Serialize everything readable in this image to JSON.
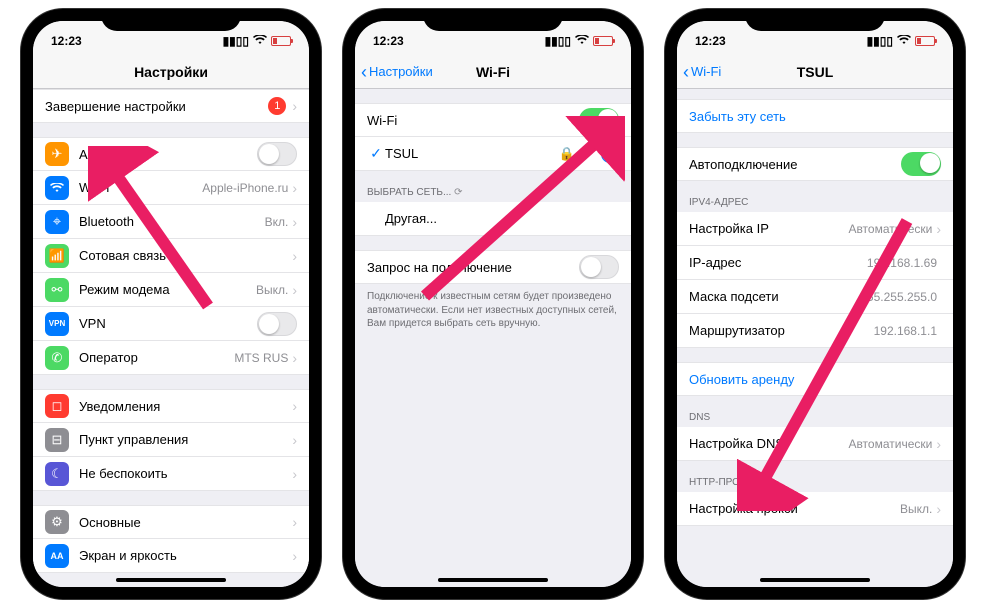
{
  "status": {
    "time": "12:23"
  },
  "phone1": {
    "title": "Настройки",
    "complete_row": {
      "label": "Завершение настройки",
      "badge": "1"
    },
    "rows": {
      "airplane": {
        "label": "Авиарежим"
      },
      "wifi": {
        "label": "Wi-Fi",
        "value": "Apple-iPhone.ru"
      },
      "bluetooth": {
        "label": "Bluetooth",
        "value": "Вкл."
      },
      "cellular": {
        "label": "Сотовая связь"
      },
      "hotspot": {
        "label": "Режим модема",
        "value": "Выкл."
      },
      "vpn": {
        "label": "VPN"
      },
      "carrier": {
        "label": "Оператор",
        "value": "MTS RUS"
      },
      "notifications": {
        "label": "Уведомления"
      },
      "control": {
        "label": "Пункт управления"
      },
      "dnd": {
        "label": "Не беспокоить"
      },
      "general": {
        "label": "Основные"
      },
      "display": {
        "label": "Экран и яркость"
      }
    }
  },
  "phone2": {
    "back": "Настройки",
    "title": "Wi-Fi",
    "wifi_label": "Wi-Fi",
    "network": "TSUL",
    "choose_header": "ВЫБРАТЬ СЕТЬ...",
    "other": "Другая...",
    "ask_label": "Запрос на подключение",
    "ask_footer": "Подключение к известным сетям будет произведено автоматически. Если нет известных доступных сетей, Вам придется выбрать сеть вручную."
  },
  "phone3": {
    "back": "Wi-Fi",
    "title": "TSUL",
    "forget": "Забыть эту сеть",
    "autojoin": "Автоподключение",
    "ipv4_header": "IPV4-АДРЕС",
    "ip_config": {
      "label": "Настройка IP",
      "value": "Автоматически"
    },
    "ip": {
      "label": "IP-адрес",
      "value": "192.168.1.69"
    },
    "mask": {
      "label": "Маска подсети",
      "value": "255.255.255.0"
    },
    "router": {
      "label": "Маршрутизатор",
      "value": "192.168.1.1"
    },
    "renew": "Обновить аренду",
    "dns_header": "DNS",
    "dns_config": {
      "label": "Настройка DNS",
      "value": "Автоматически"
    },
    "proxy_header": "HTTP-ПРОКСИ",
    "proxy": {
      "label": "Настройка прокси",
      "value": "Выкл."
    }
  }
}
